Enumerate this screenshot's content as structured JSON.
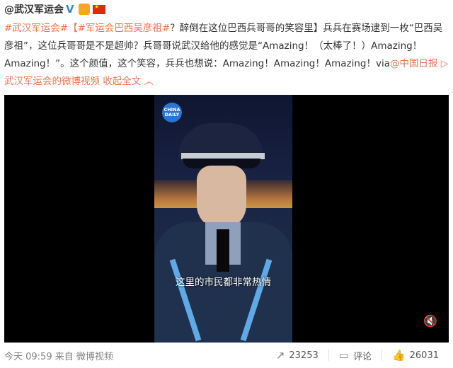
{
  "author": "@武汉军运会",
  "post": {
    "tag1": "#武汉军运会#",
    "tag2": "【#军运会巴西吴彦祖#",
    "text1": "？醉倒在这位巴西兵哥哥的笑容里】兵兵在赛场逮到一枚“巴西吴彦祖”，这位兵哥哥是不是超帅？兵哥哥说武汉给他的感觉是“Amazing！（太棒了！）Amazing！Amazing！”。这个颜值，这个笑容，兵兵也想说：Amazing！Amazing！Amazing！via",
    "via_link": "@中国日报",
    "video_link": "武汉军运会的微博视频",
    "collapse": "收起全文"
  },
  "video": {
    "logo_line1": "CHINA",
    "logo_line2": "DAILY",
    "subtitle": "这里的市民都非常热情"
  },
  "footer": {
    "time": "今天 09:59 来自 微博视频",
    "repost_count": "23253",
    "comment_label": "评论",
    "like_count": "26031"
  }
}
